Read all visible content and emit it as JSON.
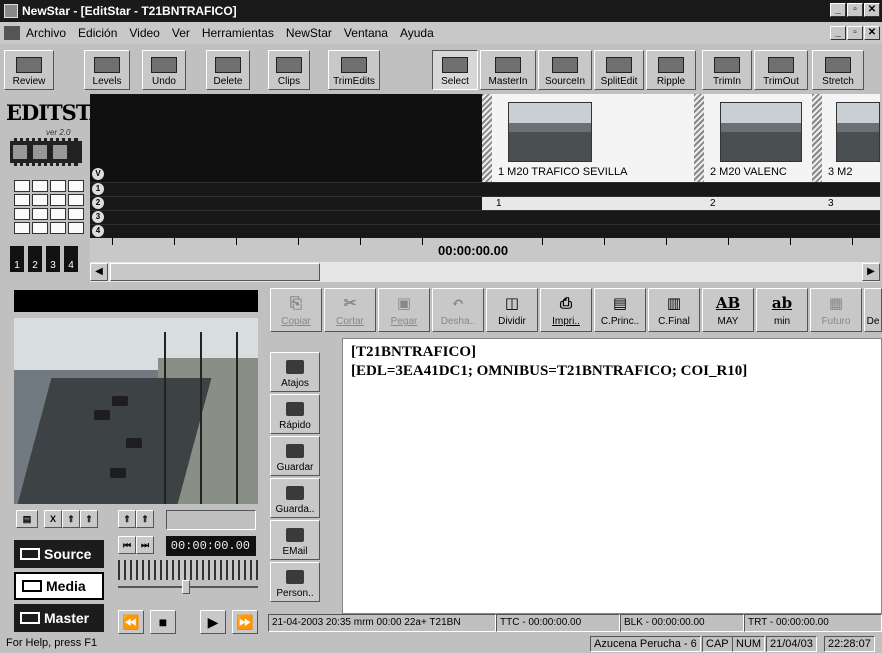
{
  "window": {
    "title": "NewStar - [EditStar - T21BNTRAFICO]"
  },
  "menu": [
    "Archivo",
    "Edición",
    "Video",
    "Ver",
    "Herramientas",
    "NewStar",
    "Ventana",
    "Ayuda"
  ],
  "toolbar": {
    "left": [
      "Review",
      "Levels",
      "Undo",
      "Delete",
      "Clips",
      "TrimEdits"
    ],
    "right": [
      "Select",
      "MasterIn",
      "SourceIn",
      "SplitEdit",
      "Ripple",
      "TrimIn",
      "TrimOut",
      "Stretch"
    ]
  },
  "logo": {
    "name": "EDITSTAR",
    "version": "ver 2.0"
  },
  "tracks": [
    "V",
    "1",
    "2",
    "3",
    "4"
  ],
  "track_buttons": [
    "1",
    "2",
    "3",
    "4"
  ],
  "clips": [
    {
      "label": "1  M20 TRAFICO SEVILLA",
      "num": "1"
    },
    {
      "label": "2  M20 VALENC",
      "num": "2"
    },
    {
      "label": "3  M2",
      "num": "3"
    }
  ],
  "timeline": {
    "timecode": "00:00:00.00"
  },
  "video": {
    "timecode": "00:00:00.00",
    "modes": [
      "Source",
      "Media",
      "Master"
    ],
    "active_mode": "Media",
    "transport": [
      "⏪",
      "■",
      "▶",
      "⏩"
    ],
    "small_buttons": [
      "X",
      "⇑",
      "⇑",
      "⇑",
      "⇑"
    ],
    "mark_buttons": [
      "⏮",
      "⏭"
    ]
  },
  "edit_toolbar": [
    {
      "label": "Copiar",
      "icon": "⎘",
      "enabled": false
    },
    {
      "label": "Cortar",
      "icon": "✂",
      "enabled": false
    },
    {
      "label": "Pegar",
      "icon": "▣",
      "enabled": false
    },
    {
      "label": "Desha..",
      "icon": "↶",
      "enabled": false
    },
    {
      "label": "Dividir",
      "icon": "◫",
      "enabled": true
    },
    {
      "label": "Impri..",
      "icon": "⎙",
      "enabled": true
    },
    {
      "label": "C.Princ..",
      "icon": "▤",
      "enabled": true
    },
    {
      "label": "C.Final",
      "icon": "▥",
      "enabled": true
    },
    {
      "label": "MAY",
      "icon": "AB",
      "enabled": true
    },
    {
      "label": "min",
      "icon": "ab",
      "enabled": true
    },
    {
      "label": "Futuro",
      "icon": "▦",
      "enabled": false
    },
    {
      "label": "De",
      "icon": "",
      "enabled": true
    }
  ],
  "side_buttons": [
    "Atajos",
    "Rápido",
    "Guardar",
    "Guarda..",
    "EMail",
    "Person.."
  ],
  "script": {
    "lines": [
      "[T21BNTRAFICO]",
      "[EDL=3EA41DC1; OMNIBUS=T21BNTRAFICO; COI_R10]"
    ]
  },
  "editor_status": {
    "info": "21-04-2003 20:35 mrm 00:00 22a+ T21BN",
    "ttc": "TTC - 00:00:00.00",
    "blk": "BLK - 00:00:00.00",
    "trt": "TRT - 00:00:00.00"
  },
  "statusbar": {
    "help": "For Help, press F1",
    "user": "Azucena Perucha - 6",
    "cap": "CAP",
    "num": "NUM",
    "date": "21/04/03",
    "time": "22:28:07"
  }
}
